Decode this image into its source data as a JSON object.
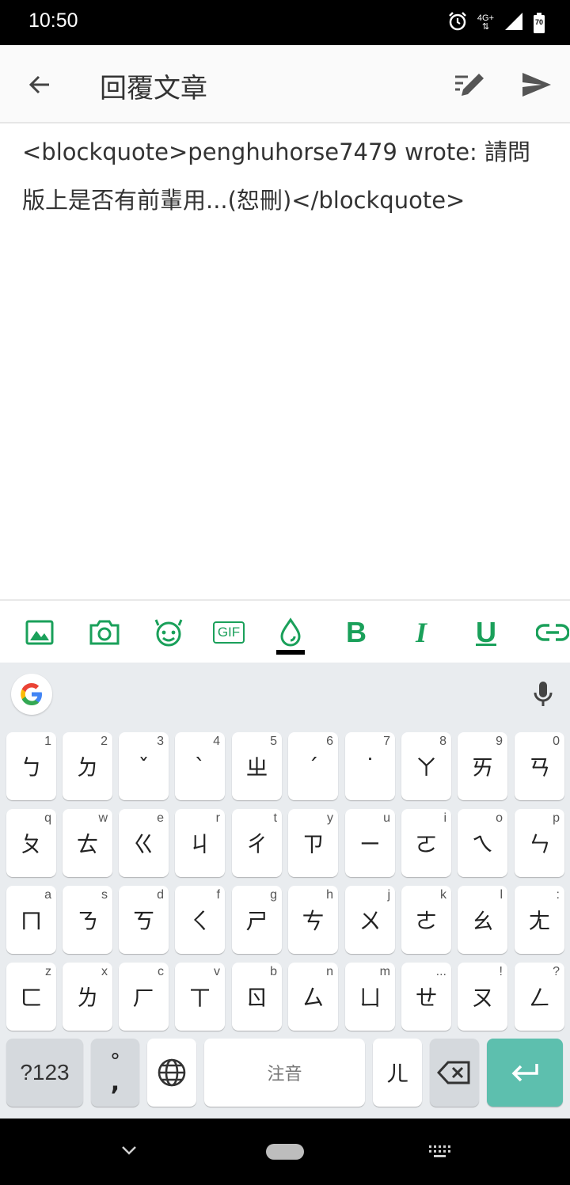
{
  "status_bar": {
    "time": "10:50",
    "network_label": "4G+",
    "battery_level": "70"
  },
  "app_bar": {
    "title": "回覆文章"
  },
  "editor": {
    "content": "<blockquote>penghuhorse7479 wrote: 請問版上是否有前輩用...(恕刪)</blockquote>"
  },
  "format_toolbar": {
    "items": [
      "image-icon",
      "camera-icon",
      "emoji-icon",
      "gif-icon",
      "color-drop-icon",
      "bold-icon",
      "italic-icon",
      "underline-icon",
      "link-icon"
    ],
    "bold_label": "B",
    "italic_label": "I",
    "underline_label": "U",
    "gif_label": "GIF",
    "accent_color": "#1aa05a"
  },
  "keyboard": {
    "rows": [
      [
        {
          "k": "ㄅ",
          "h": "1"
        },
        {
          "k": "ㄉ",
          "h": "2"
        },
        {
          "k": "ˇ",
          "h": "3"
        },
        {
          "k": "ˋ",
          "h": "4"
        },
        {
          "k": "ㄓ",
          "h": "5"
        },
        {
          "k": "ˊ",
          "h": "6"
        },
        {
          "k": "˙",
          "h": "7"
        },
        {
          "k": "ㄚ",
          "h": "8"
        },
        {
          "k": "ㄞ",
          "h": "9"
        },
        {
          "k": "ㄢ",
          "h": "0"
        }
      ],
      [
        {
          "k": "ㄆ",
          "h": "q"
        },
        {
          "k": "ㄊ",
          "h": "w"
        },
        {
          "k": "ㄍ",
          "h": "e"
        },
        {
          "k": "ㄐ",
          "h": "r"
        },
        {
          "k": "ㄔ",
          "h": "t"
        },
        {
          "k": "ㄗ",
          "h": "y"
        },
        {
          "k": "ㄧ",
          "h": "u"
        },
        {
          "k": "ㄛ",
          "h": "i"
        },
        {
          "k": "ㄟ",
          "h": "o"
        },
        {
          "k": "ㄣ",
          "h": "p"
        }
      ],
      [
        {
          "k": "ㄇ",
          "h": "a"
        },
        {
          "k": "ㄋ",
          "h": "s"
        },
        {
          "k": "ㄎ",
          "h": "d"
        },
        {
          "k": "ㄑ",
          "h": "f"
        },
        {
          "k": "ㄕ",
          "h": "g"
        },
        {
          "k": "ㄘ",
          "h": "h"
        },
        {
          "k": "ㄨ",
          "h": "j"
        },
        {
          "k": "ㄜ",
          "h": "k"
        },
        {
          "k": "ㄠ",
          "h": "l"
        },
        {
          "k": "ㄤ",
          "h": ":"
        }
      ],
      [
        {
          "k": "ㄈ",
          "h": "z"
        },
        {
          "k": "ㄌ",
          "h": "x"
        },
        {
          "k": "ㄏ",
          "h": "c"
        },
        {
          "k": "ㄒ",
          "h": "v"
        },
        {
          "k": "ㄖ",
          "h": "b"
        },
        {
          "k": "ㄙ",
          "h": "n"
        },
        {
          "k": "ㄩ",
          "h": "m"
        },
        {
          "k": "ㄝ",
          "h": "..."
        },
        {
          "k": "ㄡ",
          "h": "!"
        },
        {
          "k": "ㄥ",
          "h": "?"
        }
      ]
    ],
    "symbols_label": "?123",
    "punct_top": "°",
    "punct_bottom": ",",
    "space_label": "注音",
    "er_key": "ㄦ",
    "enter_color": "#5dbfae"
  }
}
